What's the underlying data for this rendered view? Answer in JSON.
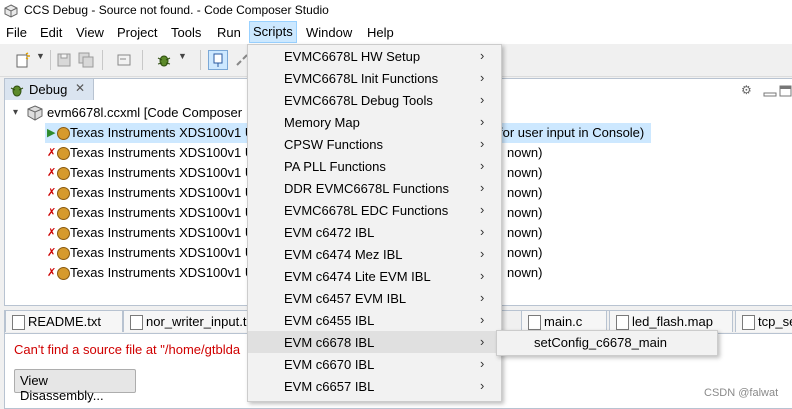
{
  "window": {
    "title": "CCS Debug - Source not found. - Code Composer Studio"
  },
  "menubar": [
    {
      "label": "File"
    },
    {
      "label": "Edit"
    },
    {
      "label": "View"
    },
    {
      "label": "Project"
    },
    {
      "label": "Tools"
    },
    {
      "label": "Run"
    },
    {
      "label": "Scripts"
    },
    {
      "label": "Window"
    },
    {
      "label": "Help"
    }
  ],
  "debug_view": {
    "tab_label": "Debug",
    "root": "evm6678l.ccxml [Code Composer",
    "items": [
      {
        "left": "Texas Instruments XDS100v1 U",
        "right": "for user input in Console)"
      },
      {
        "left": "Texas Instruments XDS100v1 U",
        "right": "nown)"
      },
      {
        "left": "Texas Instruments XDS100v1 U",
        "right": "nown)"
      },
      {
        "left": "Texas Instruments XDS100v1 U",
        "right": "nown)"
      },
      {
        "left": "Texas Instruments XDS100v1 U",
        "right": "nown)"
      },
      {
        "left": "Texas Instruments XDS100v1 U",
        "right": "nown)"
      },
      {
        "left": "Texas Instruments XDS100v1 U",
        "right": "nown)"
      },
      {
        "left": "Texas Instruments XDS100v1 U",
        "right": "nown)"
      }
    ]
  },
  "editor": {
    "tabs": [
      {
        "label": "README.txt"
      },
      {
        "label": "nor_writer_input.t"
      },
      {
        "label": "main.c"
      },
      {
        "label": "led_flash.map"
      },
      {
        "label": "tcp_se"
      }
    ],
    "error_text": "Can't find a source file at \"/home/gtblda",
    "button_label": "View Disassembly..."
  },
  "scripts_menu": {
    "items": [
      {
        "label": "EVMC6678L HW Setup"
      },
      {
        "label": "EVMC6678L Init Functions"
      },
      {
        "label": "EVMC6678L Debug Tools"
      },
      {
        "label": "Memory Map"
      },
      {
        "label": "CPSW Functions"
      },
      {
        "label": "PA PLL Functions"
      },
      {
        "label": "DDR EVMC6678L Functions"
      },
      {
        "label": "EVMC6678L EDC Functions"
      },
      {
        "label": "EVM c6472 IBL"
      },
      {
        "label": "EVM c6474 Mez IBL"
      },
      {
        "label": "EVM c6474 Lite EVM IBL"
      },
      {
        "label": "EVM c6457 EVM IBL"
      },
      {
        "label": "EVM c6455 IBL"
      },
      {
        "label": "EVM c6678 IBL"
      },
      {
        "label": "EVM c6670 IBL"
      },
      {
        "label": "EVM c6657 IBL"
      }
    ],
    "arrow": "›",
    "highlighted_index": 13
  },
  "submenu": {
    "items": [
      {
        "label": "setConfig_c6678_main"
      }
    ]
  },
  "watermark": "CSDN @falwat",
  "colors": {
    "error": "#d00000",
    "selection": "#cde8ff",
    "menu_active": "#cce8ff"
  }
}
